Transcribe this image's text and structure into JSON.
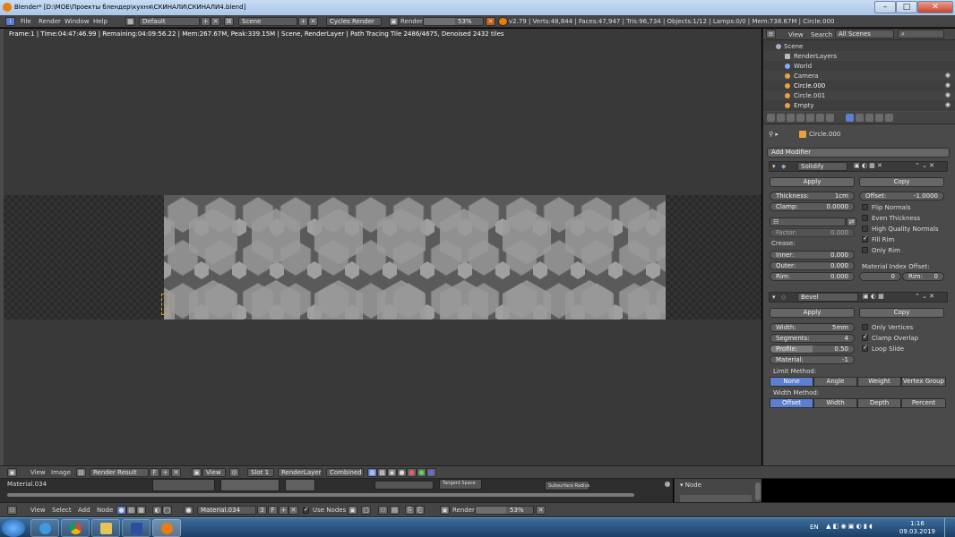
{
  "window": {
    "title": "Blender* [D:\\MOE\\Проекты блендер\\кухня\\СКИНАЛИ\\СКИНАЛИ4.blend]"
  },
  "info_header": {
    "menus": [
      "File",
      "Render",
      "Window",
      "Help"
    ],
    "screen_layout": "Default",
    "scene": "Scene",
    "engine": "Cycles Render",
    "render_label": "Render",
    "render_progress": "53%",
    "render_fraction": 0.53,
    "stats": "v2.79 | Verts:48,844 | Faces:47,947 | Tris:96,734 | Objects:1/12 | Lamps:0/0 | Mem:738.67M | Circle.000"
  },
  "viewport": {
    "frame_info": "Frame:1 | Time:04:47:46.99 | Remaining:04:09:56.22 | Mem:267.67M, Peak:339.15M | Scene, RenderLayer | Path Tracing Tile 2486/4675, Denoised 2432 tiles"
  },
  "outliner": {
    "view_label": "View",
    "search_label": "Search",
    "scope": "All Scenes",
    "items": [
      {
        "name": "Scene",
        "indent": 0
      },
      {
        "name": "RenderLayers",
        "indent": 1
      },
      {
        "name": "World",
        "indent": 1
      },
      {
        "name": "Camera",
        "indent": 1
      },
      {
        "name": "Circle.000",
        "indent": 1
      },
      {
        "name": "Circle.001",
        "indent": 1
      },
      {
        "name": "Empty",
        "indent": 1
      }
    ]
  },
  "properties": {
    "object_name": "Circle.000",
    "add_modifier": "Add Modifier",
    "solidify": {
      "name": "Solidify",
      "apply": "Apply",
      "copy": "Copy",
      "thickness_label": "Thickness:",
      "thickness_value": "1cm",
      "clamp_label": "Clamp:",
      "clamp_value": "0.0000",
      "offset_label": "Offset:",
      "offset_value": "-1.0000",
      "flip_normals": "Flip Normals",
      "even_thickness": "Even Thickness",
      "high_quality_normals": "High Quality Normals",
      "fill_rim": "Fill Rim",
      "only_rim": "Only Rim",
      "factor_label": "Factor:",
      "factor_value": "0.000",
      "crease_label": "Crease:",
      "inner_label": "Inner:",
      "inner_value": "0.000",
      "outer_label": "Outer:",
      "outer_value": "0.000",
      "rim_label": "Rim:",
      "rim_value": "0.000",
      "material_index_offset": "Material Index Offset:",
      "mio_value": "0",
      "mio_rim_label": "Rim:",
      "mio_rim_value": "0"
    },
    "bevel": {
      "name": "Bevel",
      "apply": "Apply",
      "copy": "Copy",
      "width_label": "Width:",
      "width_value": "5mm",
      "segments_label": "Segments:",
      "segments_value": "4",
      "profile_label": "Profile:",
      "profile_value": "0.50",
      "material_label": "Material:",
      "material_value": "-1",
      "only_vertices": "Only Vertices",
      "clamp_overlap": "Clamp Overlap",
      "loop_slide": "Loop Slide",
      "limit_method_label": "Limit Method:",
      "limit_methods": [
        "None",
        "Angle",
        "Weight",
        "Vertex Group"
      ],
      "width_method_label": "Width Method:",
      "width_methods": [
        "Offset",
        "Width",
        "Depth",
        "Percent"
      ]
    }
  },
  "image_editor_header": {
    "menus": [
      "View",
      "Image"
    ],
    "image": "Render Result",
    "fake_user": "F",
    "view_label": "View",
    "slot": "Slot 1",
    "layer": "RenderLayer",
    "pass": "Combined"
  },
  "node_editor": {
    "material_label": "Material.034",
    "node_panel_title": "Node",
    "node_labels": [
      "Tangent Space",
      "Subsurface Radius"
    ],
    "header_menus": [
      "View",
      "Select",
      "Add",
      "Node"
    ],
    "material": "Material.034",
    "users": "3",
    "fake_user": "F",
    "use_nodes": "Use Nodes",
    "render_label": "Render",
    "render_progress": "53%"
  },
  "taskbar": {
    "language": "EN",
    "time": "1:16",
    "date": "09.03.2019"
  }
}
